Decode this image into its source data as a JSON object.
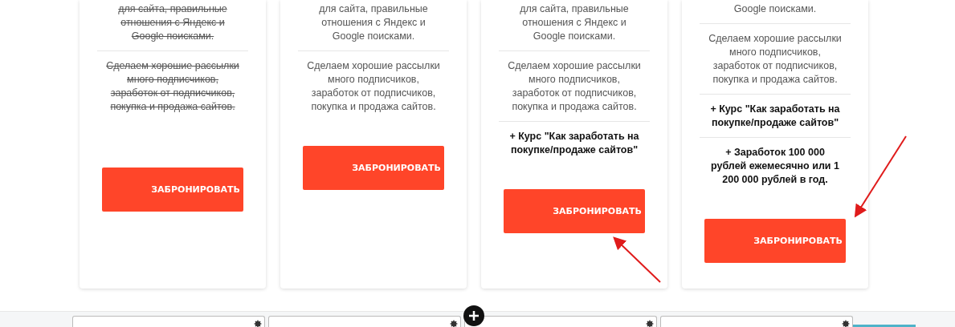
{
  "cards": [
    {
      "sections": [
        {
          "text": "для сайта, правильные\nотношения с Яндекс и\nGoogle поисками.",
          "bold": false,
          "struck": true
        },
        {
          "text": "Сделаем хорошие рассылки\nмного подписчиков,\nзаработок от подписчиков,\nпокупка и продажа сайтов.",
          "bold": false,
          "struck": true
        }
      ],
      "button": "ЗАБРОНИРОВАТЬ"
    },
    {
      "sections": [
        {
          "text": "для сайта, правильные\nотношения с Яндекс и\nGoogle поисками.",
          "bold": false,
          "struck": false
        },
        {
          "text": "Сделаем хорошие рассылки\nмного подписчиков,\nзаработок от подписчиков,\nпокупка и продажа сайтов.",
          "bold": false,
          "struck": false
        }
      ],
      "button": "ЗАБРОНИРОВАТЬ"
    },
    {
      "sections": [
        {
          "text": "для сайта, правильные\nотношения с Яндекс и\nGoogle поисками.",
          "bold": false,
          "struck": false
        },
        {
          "text": "Сделаем хорошие рассылки\nмного подписчиков,\nзаработок от подписчиков,\nпокупка и продажа сайтов.",
          "bold": false,
          "struck": false
        },
        {
          "text": "+ Курс \"Как заработать на\nпокупке/продаже сайтов\"",
          "bold": true,
          "struck": false
        }
      ],
      "button": "ЗАБРОНИРОВАТЬ"
    },
    {
      "sections": [
        {
          "text": "Google поисками.",
          "bold": false,
          "struck": false
        },
        {
          "text": "Сделаем хорошие рассылки\nмного подписчиков,\nзаработок от подписчиков,\nпокупка и продажа сайтов.",
          "bold": false,
          "struck": false
        },
        {
          "text": "+ Курс \"Как заработать на\nпокупке/продаже сайтов\"",
          "bold": true,
          "struck": false
        },
        {
          "text": "+ Заработок 100 000\nрублей ежемесячно или 1\n200 000 рублей в год.",
          "bold": true,
          "struck": false
        }
      ],
      "button": "ЗАБРОНИРОВАТЬ"
    }
  ]
}
